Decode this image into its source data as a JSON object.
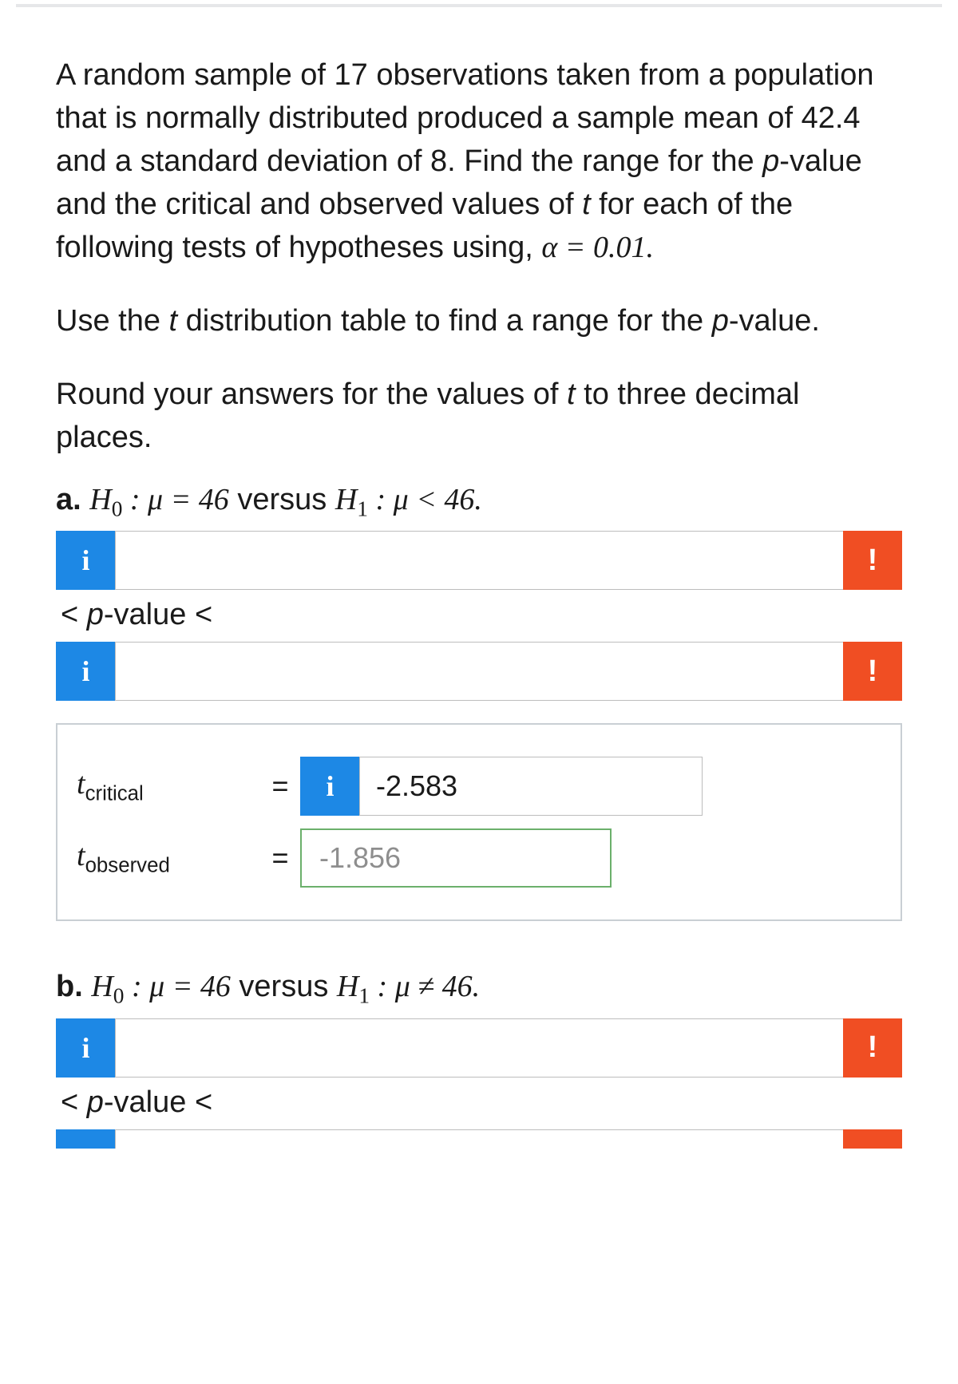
{
  "problem": {
    "p1": "A random sample of 17 observations taken from a population that is normally distributed produced a sample mean of 42.4 and a standard deviation of 8. Find the range for the ",
    "p1_tail": "-value and the critical and observed values of ",
    "p1_tail2": " for each of the following tests of hypotheses using, ",
    "alpha_eq": "α = 0.01.",
    "p2a": "Use the ",
    "p2b": " distribution table to find a range for the ",
    "p2c": "-value.",
    "p3a": "Round your answers for the values of ",
    "p3b": " to three decimal places."
  },
  "partA": {
    "label": "a.",
    "h0_lhs": "H",
    "h0_sub": "0",
    "h0_colon": " : μ = 46",
    "versus": " versus ",
    "h1_lhs": "H",
    "h1_sub": "1",
    "h1_colon": " : μ < 46.",
    "pvalue_label": "< p-value <",
    "tcrit_label": "t",
    "tcrit_sub": "critical",
    "tobs_label": "t",
    "tobs_sub": "observed",
    "tcrit_value": "-2.583",
    "tobs_value": "-1.856"
  },
  "partB": {
    "label": "b.",
    "h0_lhs": "H",
    "h0_sub": "0",
    "h0_colon": " : μ = 46",
    "versus": " versus ",
    "h1_lhs": "H",
    "h1_sub": "1",
    "h1_colon": " : μ ≠ 46.",
    "pvalue_label": "< p-value <"
  },
  "icons": {
    "info": "i",
    "alert": "!"
  }
}
